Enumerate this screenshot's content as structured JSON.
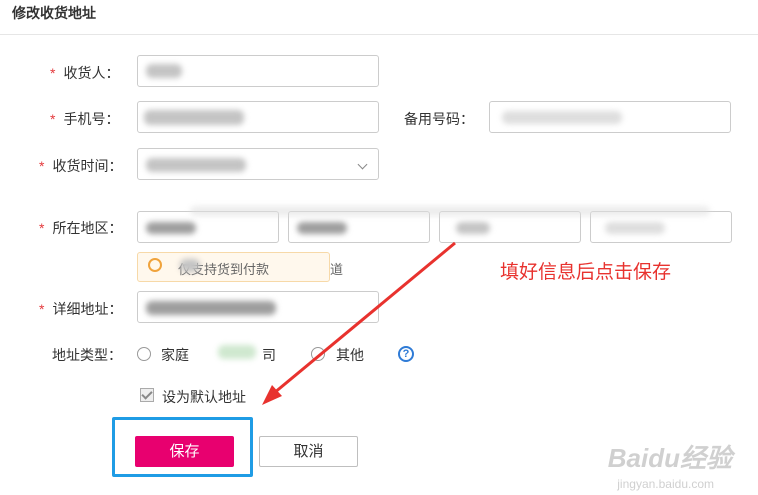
{
  "header": {
    "title": "修改收货地址"
  },
  "form": {
    "required_mark": "*",
    "consignee": {
      "label": "收货人："
    },
    "phone": {
      "label": "手机号："
    },
    "backup_phone": {
      "label": "备用号码："
    },
    "delivery_time": {
      "label": "收货时间："
    },
    "region": {
      "label": "所在地区：",
      "tip_partial": "仅支持货到付款",
      "tip_trailing": "道"
    },
    "detail_address": {
      "label": "详细地址："
    },
    "address_type": {
      "label": "地址类型：",
      "options": [
        {
          "label": "家庭"
        },
        {
          "label": "司"
        },
        {
          "label": "其他"
        }
      ],
      "help_icon": "?"
    },
    "default_address": {
      "label": "设为默认地址",
      "checked": true
    }
  },
  "actions": {
    "save_label": "保存",
    "cancel_label": "取消"
  },
  "annotation": {
    "text": "填好信息后点击保存",
    "color": "#e8322e"
  },
  "watermark": {
    "brand": "Baidu经验",
    "url": "jingyan.baidu.com"
  },
  "colors": {
    "primary": "#e8006f",
    "highlight": "#1f9ce5",
    "required": "#e4393c",
    "link": "#2f7bd6"
  }
}
